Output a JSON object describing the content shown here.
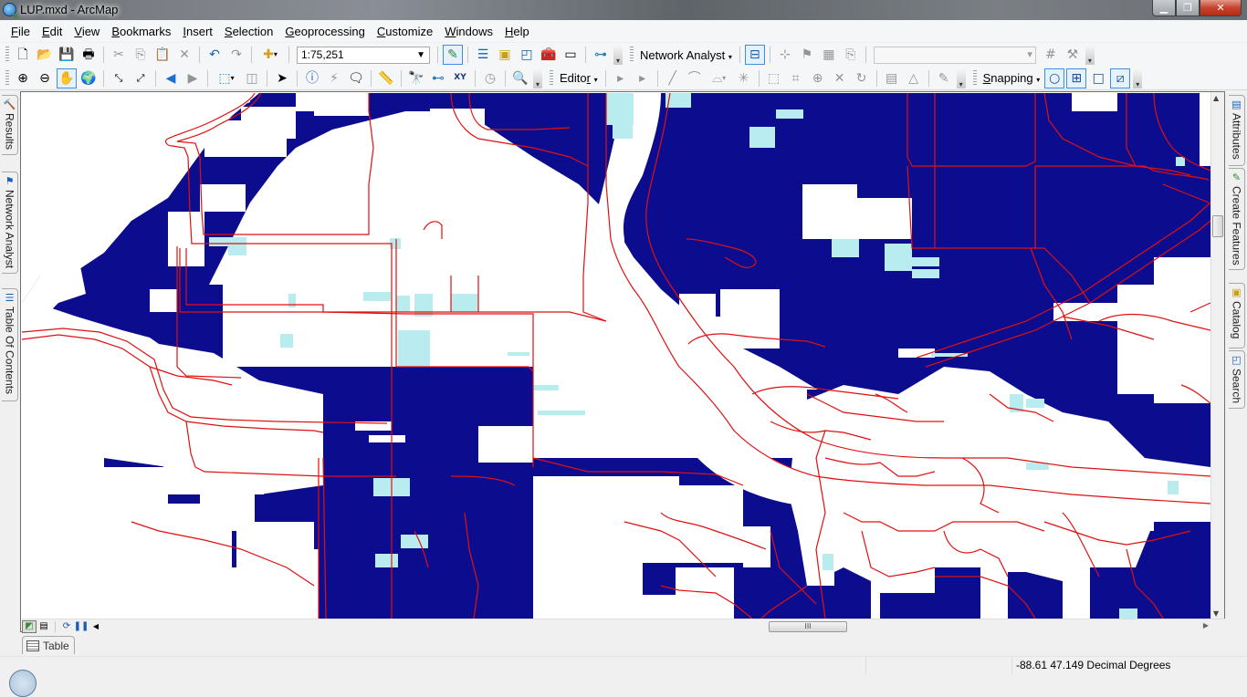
{
  "window": {
    "title": "LUP.mxd - ArcMap",
    "controls": {
      "minimize": "minimize",
      "restore": "restore",
      "close": "close"
    }
  },
  "menubar": {
    "items": [
      {
        "label": "File",
        "mnemonic": "F"
      },
      {
        "label": "Edit",
        "mnemonic": "E"
      },
      {
        "label": "View",
        "mnemonic": "V"
      },
      {
        "label": "Bookmarks",
        "mnemonic": "B"
      },
      {
        "label": "Insert",
        "mnemonic": "I"
      },
      {
        "label": "Selection",
        "mnemonic": "S"
      },
      {
        "label": "Geoprocessing",
        "mnemonic": "G"
      },
      {
        "label": "Customize",
        "mnemonic": "C"
      },
      {
        "label": "Windows",
        "mnemonic": "W"
      },
      {
        "label": "Help",
        "mnemonic": "H"
      }
    ]
  },
  "standard_toolbar": {
    "buttons": [
      "new-document",
      "open",
      "save",
      "print",
      "cut",
      "copy",
      "paste",
      "delete",
      "undo",
      "redo",
      "add-data"
    ],
    "scale": "1:75,251",
    "right_buttons": [
      "editor-toolbar",
      "table-of-contents",
      "catalog",
      "search",
      "arctoolbox",
      "python",
      "modelbuilder"
    ]
  },
  "network_analyst_toolbar": {
    "label": "Network Analyst",
    "buttons": [
      "network-analyst-window",
      "create-network-location",
      "select-move-location",
      "build-network",
      "directions"
    ],
    "combo_value": ""
  },
  "tools_toolbar": {
    "buttons": [
      "zoom-in",
      "zoom-out",
      "pan",
      "full-extent",
      "fixed-zoom-in",
      "fixed-zoom-out",
      "go-back",
      "go-forward",
      "select-features",
      "clear-selection",
      "select-elements",
      "identify",
      "hyperlink",
      "html-popup",
      "measure",
      "find",
      "find-route",
      "go-to-xy",
      "time-slider",
      "magnifier"
    ],
    "active": "pan"
  },
  "editor_toolbar": {
    "label": "Editor",
    "mnemonic": "r"
  },
  "snapping_toolbar": {
    "label": "Snapping",
    "mnemonic": "S",
    "buttons": [
      {
        "name": "point-snapping",
        "active": true
      },
      {
        "name": "end-snapping",
        "active": true
      },
      {
        "name": "vertex-snapping",
        "active": false
      },
      {
        "name": "edge-snapping",
        "active": true
      }
    ]
  },
  "left_dock": {
    "tabs": [
      {
        "label": "Results",
        "icon": "hammer-icon"
      },
      {
        "label": "Network Analyst",
        "icon": "network-analyst-icon"
      },
      {
        "label": "Table Of Contents",
        "icon": "toc-icon"
      }
    ]
  },
  "right_dock": {
    "tabs": [
      {
        "label": "Attributes",
        "icon": "attributes-icon"
      },
      {
        "label": "Create Features",
        "icon": "create-features-icon"
      },
      {
        "label": "Catalog",
        "icon": "catalog-icon"
      },
      {
        "label": "Search",
        "icon": "search-icon"
      }
    ]
  },
  "map": {
    "layers": [
      {
        "name": "land-use-parcels",
        "color": "#0c0c8f"
      },
      {
        "name": "land-use-secondary",
        "color": "#b8ecee"
      },
      {
        "name": "roads",
        "color": "#e01010"
      }
    ],
    "background": "#ffffff"
  },
  "map_view_bar": {
    "buttons": [
      "data-view",
      "layout-view",
      "refresh",
      "pause-drawing",
      "scroll-left"
    ],
    "hscroll_grip": "III"
  },
  "table_tab": {
    "label": "Table"
  },
  "status": {
    "coordinates": "-88.61  47.149 Decimal Degrees"
  }
}
